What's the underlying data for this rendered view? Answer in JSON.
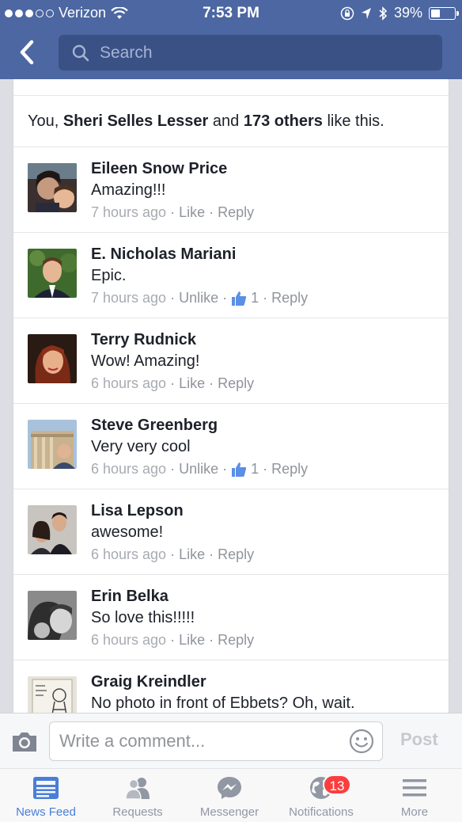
{
  "status_bar": {
    "carrier": "Verizon",
    "time": "7:53 PM",
    "battery": "39%"
  },
  "nav": {
    "search_placeholder": "Search"
  },
  "likes": {
    "prefix": "You, ",
    "name": "Sheri Selles Lesser",
    "middle": " and ",
    "count": "173 others",
    "suffix": " like this."
  },
  "comments": [
    {
      "name": "Eileen Snow Price",
      "text": "Amazing!!!",
      "time": "7 hours ago",
      "like": "Like",
      "reply": "Reply",
      "like_count": ""
    },
    {
      "name": "E. Nicholas Mariani",
      "text": "Epic.",
      "time": "7 hours ago",
      "like": "Unlike",
      "reply": "Reply",
      "like_count": "1"
    },
    {
      "name": "Terry Rudnick",
      "text": "Wow! Amazing!",
      "time": "6 hours ago",
      "like": "Like",
      "reply": "Reply",
      "like_count": ""
    },
    {
      "name": "Steve Greenberg",
      "text": "Very very cool",
      "time": "6 hours ago",
      "like": "Unlike",
      "reply": "Reply",
      "like_count": "1"
    },
    {
      "name": "Lisa Lepson",
      "text": "awesome!",
      "time": "6 hours ago",
      "like": "Like",
      "reply": "Reply",
      "like_count": ""
    },
    {
      "name": "Erin Belka",
      "text": "So love this!!!!!",
      "time": "6 hours ago",
      "like": "Like",
      "reply": "Reply",
      "like_count": ""
    },
    {
      "name": "Graig Kreindler",
      "text": "No photo in front of Ebbets? Oh, wait.",
      "time": "",
      "like": "",
      "reply": "",
      "like_count": ""
    }
  ],
  "composer": {
    "placeholder": "Write a comment...",
    "post_label": "Post"
  },
  "tabs": [
    {
      "label": "News Feed",
      "icon": "news-feed-icon",
      "active": true
    },
    {
      "label": "Requests",
      "icon": "friends-icon"
    },
    {
      "label": "Messenger",
      "icon": "messenger-icon"
    },
    {
      "label": "Notifications",
      "icon": "globe-icon",
      "badge": "13"
    },
    {
      "label": "More",
      "icon": "menu-icon"
    }
  ],
  "colors": {
    "brand": "#4c67a1",
    "active_tab": "#4a7ed8",
    "badge": "#fa3e3e"
  }
}
